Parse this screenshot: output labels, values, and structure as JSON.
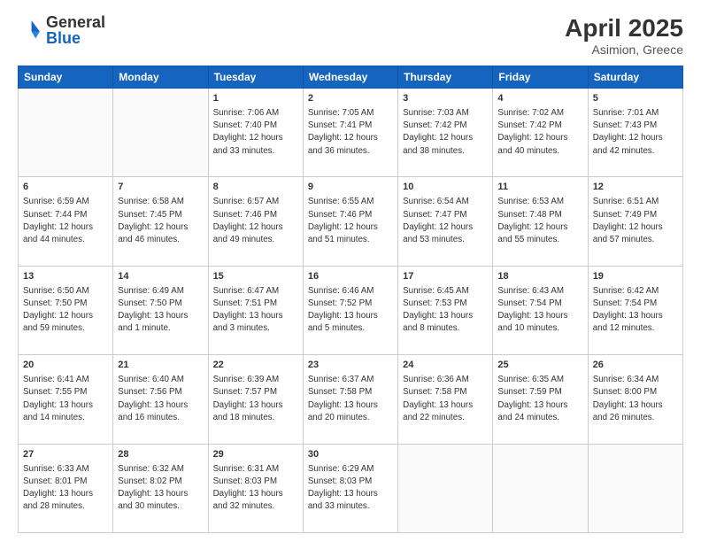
{
  "header": {
    "logo_general": "General",
    "logo_blue": "Blue",
    "month_year": "April 2025",
    "location": "Asimion, Greece"
  },
  "weekdays": [
    "Sunday",
    "Monday",
    "Tuesday",
    "Wednesday",
    "Thursday",
    "Friday",
    "Saturday"
  ],
  "weeks": [
    [
      {
        "day": "",
        "info": ""
      },
      {
        "day": "",
        "info": ""
      },
      {
        "day": "1",
        "info": "Sunrise: 7:06 AM\nSunset: 7:40 PM\nDaylight: 12 hours and 33 minutes."
      },
      {
        "day": "2",
        "info": "Sunrise: 7:05 AM\nSunset: 7:41 PM\nDaylight: 12 hours and 36 minutes."
      },
      {
        "day": "3",
        "info": "Sunrise: 7:03 AM\nSunset: 7:42 PM\nDaylight: 12 hours and 38 minutes."
      },
      {
        "day": "4",
        "info": "Sunrise: 7:02 AM\nSunset: 7:42 PM\nDaylight: 12 hours and 40 minutes."
      },
      {
        "day": "5",
        "info": "Sunrise: 7:01 AM\nSunset: 7:43 PM\nDaylight: 12 hours and 42 minutes."
      }
    ],
    [
      {
        "day": "6",
        "info": "Sunrise: 6:59 AM\nSunset: 7:44 PM\nDaylight: 12 hours and 44 minutes."
      },
      {
        "day": "7",
        "info": "Sunrise: 6:58 AM\nSunset: 7:45 PM\nDaylight: 12 hours and 46 minutes."
      },
      {
        "day": "8",
        "info": "Sunrise: 6:57 AM\nSunset: 7:46 PM\nDaylight: 12 hours and 49 minutes."
      },
      {
        "day": "9",
        "info": "Sunrise: 6:55 AM\nSunset: 7:46 PM\nDaylight: 12 hours and 51 minutes."
      },
      {
        "day": "10",
        "info": "Sunrise: 6:54 AM\nSunset: 7:47 PM\nDaylight: 12 hours and 53 minutes."
      },
      {
        "day": "11",
        "info": "Sunrise: 6:53 AM\nSunset: 7:48 PM\nDaylight: 12 hours and 55 minutes."
      },
      {
        "day": "12",
        "info": "Sunrise: 6:51 AM\nSunset: 7:49 PM\nDaylight: 12 hours and 57 minutes."
      }
    ],
    [
      {
        "day": "13",
        "info": "Sunrise: 6:50 AM\nSunset: 7:50 PM\nDaylight: 12 hours and 59 minutes."
      },
      {
        "day": "14",
        "info": "Sunrise: 6:49 AM\nSunset: 7:50 PM\nDaylight: 13 hours and 1 minute."
      },
      {
        "day": "15",
        "info": "Sunrise: 6:47 AM\nSunset: 7:51 PM\nDaylight: 13 hours and 3 minutes."
      },
      {
        "day": "16",
        "info": "Sunrise: 6:46 AM\nSunset: 7:52 PM\nDaylight: 13 hours and 5 minutes."
      },
      {
        "day": "17",
        "info": "Sunrise: 6:45 AM\nSunset: 7:53 PM\nDaylight: 13 hours and 8 minutes."
      },
      {
        "day": "18",
        "info": "Sunrise: 6:43 AM\nSunset: 7:54 PM\nDaylight: 13 hours and 10 minutes."
      },
      {
        "day": "19",
        "info": "Sunrise: 6:42 AM\nSunset: 7:54 PM\nDaylight: 13 hours and 12 minutes."
      }
    ],
    [
      {
        "day": "20",
        "info": "Sunrise: 6:41 AM\nSunset: 7:55 PM\nDaylight: 13 hours and 14 minutes."
      },
      {
        "day": "21",
        "info": "Sunrise: 6:40 AM\nSunset: 7:56 PM\nDaylight: 13 hours and 16 minutes."
      },
      {
        "day": "22",
        "info": "Sunrise: 6:39 AM\nSunset: 7:57 PM\nDaylight: 13 hours and 18 minutes."
      },
      {
        "day": "23",
        "info": "Sunrise: 6:37 AM\nSunset: 7:58 PM\nDaylight: 13 hours and 20 minutes."
      },
      {
        "day": "24",
        "info": "Sunrise: 6:36 AM\nSunset: 7:58 PM\nDaylight: 13 hours and 22 minutes."
      },
      {
        "day": "25",
        "info": "Sunrise: 6:35 AM\nSunset: 7:59 PM\nDaylight: 13 hours and 24 minutes."
      },
      {
        "day": "26",
        "info": "Sunrise: 6:34 AM\nSunset: 8:00 PM\nDaylight: 13 hours and 26 minutes."
      }
    ],
    [
      {
        "day": "27",
        "info": "Sunrise: 6:33 AM\nSunset: 8:01 PM\nDaylight: 13 hours and 28 minutes."
      },
      {
        "day": "28",
        "info": "Sunrise: 6:32 AM\nSunset: 8:02 PM\nDaylight: 13 hours and 30 minutes."
      },
      {
        "day": "29",
        "info": "Sunrise: 6:31 AM\nSunset: 8:03 PM\nDaylight: 13 hours and 32 minutes."
      },
      {
        "day": "30",
        "info": "Sunrise: 6:29 AM\nSunset: 8:03 PM\nDaylight: 13 hours and 33 minutes."
      },
      {
        "day": "",
        "info": ""
      },
      {
        "day": "",
        "info": ""
      },
      {
        "day": "",
        "info": ""
      }
    ]
  ]
}
